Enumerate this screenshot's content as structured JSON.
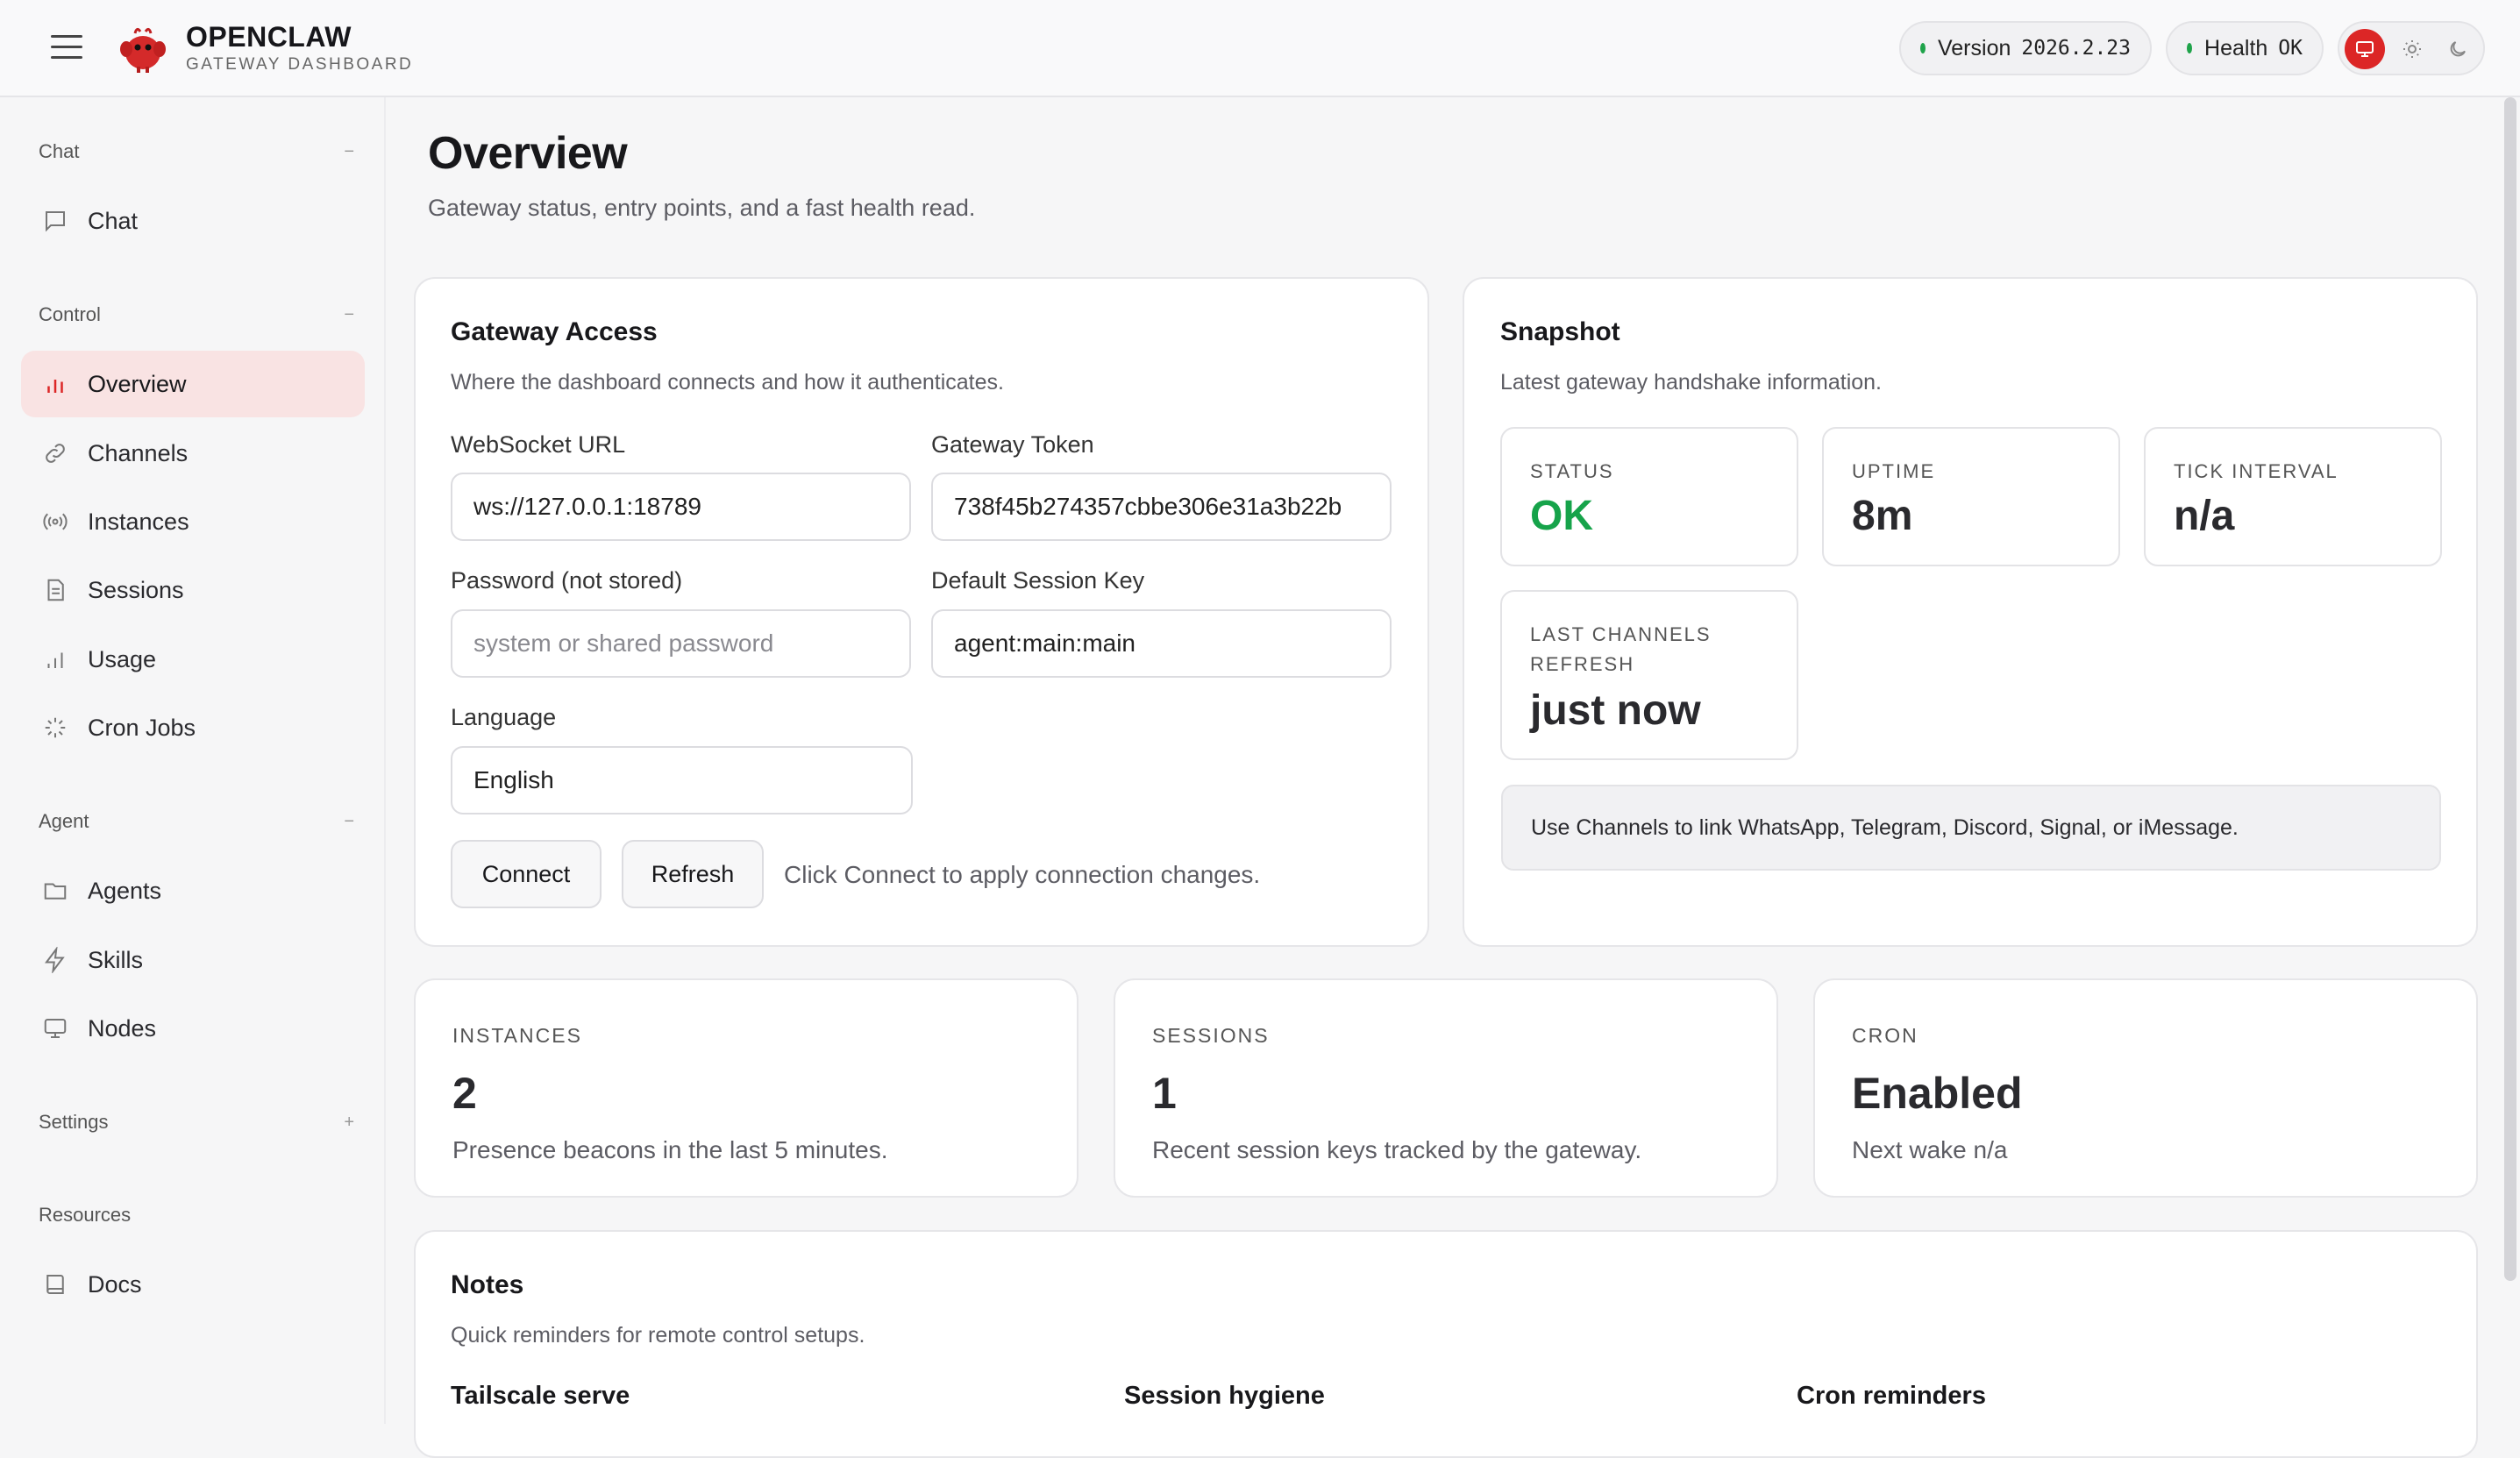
{
  "brand": {
    "title": "OPENCLAW",
    "subtitle": "GATEWAY DASHBOARD"
  },
  "header": {
    "version_label": "Version",
    "version_value": "2026.2.23",
    "health_label": "Health",
    "health_value": "OK",
    "status_color": "#1fa34a",
    "accent_color": "#dc2626"
  },
  "sidebar": {
    "groups": [
      {
        "label": "Chat",
        "toggle": "−"
      },
      {
        "label": "Control",
        "toggle": "−"
      },
      {
        "label": "Agent",
        "toggle": "−"
      },
      {
        "label": "Settings",
        "toggle": "+"
      },
      {
        "label": "Resources",
        "toggle": ""
      }
    ],
    "items": [
      {
        "label": "Chat",
        "icon": "message-icon"
      },
      {
        "label": "Overview",
        "icon": "bar-chart-icon",
        "active": true
      },
      {
        "label": "Channels",
        "icon": "link-icon"
      },
      {
        "label": "Instances",
        "icon": "broadcast-icon"
      },
      {
        "label": "Sessions",
        "icon": "document-icon"
      },
      {
        "label": "Usage",
        "icon": "bar-chart-icon"
      },
      {
        "label": "Cron Jobs",
        "icon": "loader-icon"
      },
      {
        "label": "Agents",
        "icon": "folder-icon"
      },
      {
        "label": "Skills",
        "icon": "lightning-icon"
      },
      {
        "label": "Nodes",
        "icon": "monitor-icon"
      },
      {
        "label": "Docs",
        "icon": "book-icon"
      }
    ]
  },
  "page": {
    "title": "Overview",
    "subtitle": "Gateway status, entry points, and a fast health read."
  },
  "gateway_access": {
    "title": "Gateway Access",
    "subtitle": "Where the dashboard connects and how it authenticates.",
    "websocket_label": "WebSocket URL",
    "websocket_value": "ws://127.0.0.1:18789",
    "token_label": "Gateway Token",
    "token_value": "738f45b274357cbbe306e31a3b22b",
    "password_label": "Password (not stored)",
    "password_placeholder": "system or shared password",
    "session_key_label": "Default Session Key",
    "session_key_value": "agent:main:main",
    "language_label": "Language",
    "language_value": "English",
    "connect_label": "Connect",
    "refresh_label": "Refresh",
    "hint": "Click Connect to apply connection changes."
  },
  "snapshot": {
    "title": "Snapshot",
    "subtitle": "Latest gateway handshake information.",
    "status_label": "STATUS",
    "status_value": "OK",
    "uptime_label": "UPTIME",
    "uptime_value": "8m",
    "tick_label": "TICK INTERVAL",
    "tick_value": "n/a",
    "last_refresh_label_1": "LAST CHANNELS",
    "last_refresh_label_2": "REFRESH",
    "last_refresh_value": "just now",
    "callout": "Use Channels to link WhatsApp, Telegram, Discord, Signal, or iMessage."
  },
  "metrics": {
    "instances": {
      "label": "INSTANCES",
      "value": "2",
      "desc": "Presence beacons in the last 5 minutes."
    },
    "sessions": {
      "label": "SESSIONS",
      "value": "1",
      "desc": "Recent session keys tracked by the gateway."
    },
    "cron": {
      "label": "CRON",
      "value": "Enabled",
      "desc": "Next wake n/a"
    }
  },
  "notes": {
    "title": "Notes",
    "subtitle": "Quick reminders for remote control setups.",
    "items": [
      "Tailscale serve",
      "Session hygiene",
      "Cron reminders"
    ]
  }
}
